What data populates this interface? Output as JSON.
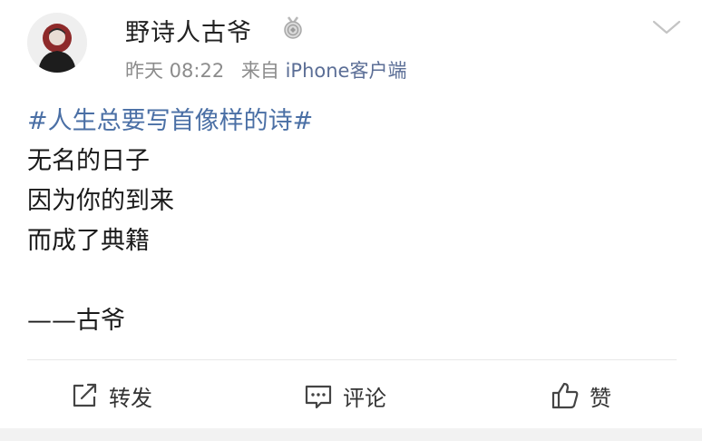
{
  "post": {
    "author": "野诗人古爷",
    "time": "昨天 08:22",
    "source_prefix": "来自",
    "source_device": "iPhone客户端",
    "topic": "#人生总要写首像样的诗#",
    "lines": [
      "无名的日子",
      "因为你的到来",
      "而成了典籍",
      "",
      "——古爷"
    ]
  },
  "actions": {
    "repost_label": "转发",
    "comment_label": "评论",
    "like_label": "赞"
  },
  "icons": {
    "badge": "medal-icon",
    "menu": "chevron-down-icon",
    "repost": "share-icon",
    "comment": "comment-icon",
    "like": "thumbs-up-icon"
  },
  "colors": {
    "topic": "#4a6fa5",
    "device": "#5b6e96",
    "meta": "#8c8c8c"
  }
}
